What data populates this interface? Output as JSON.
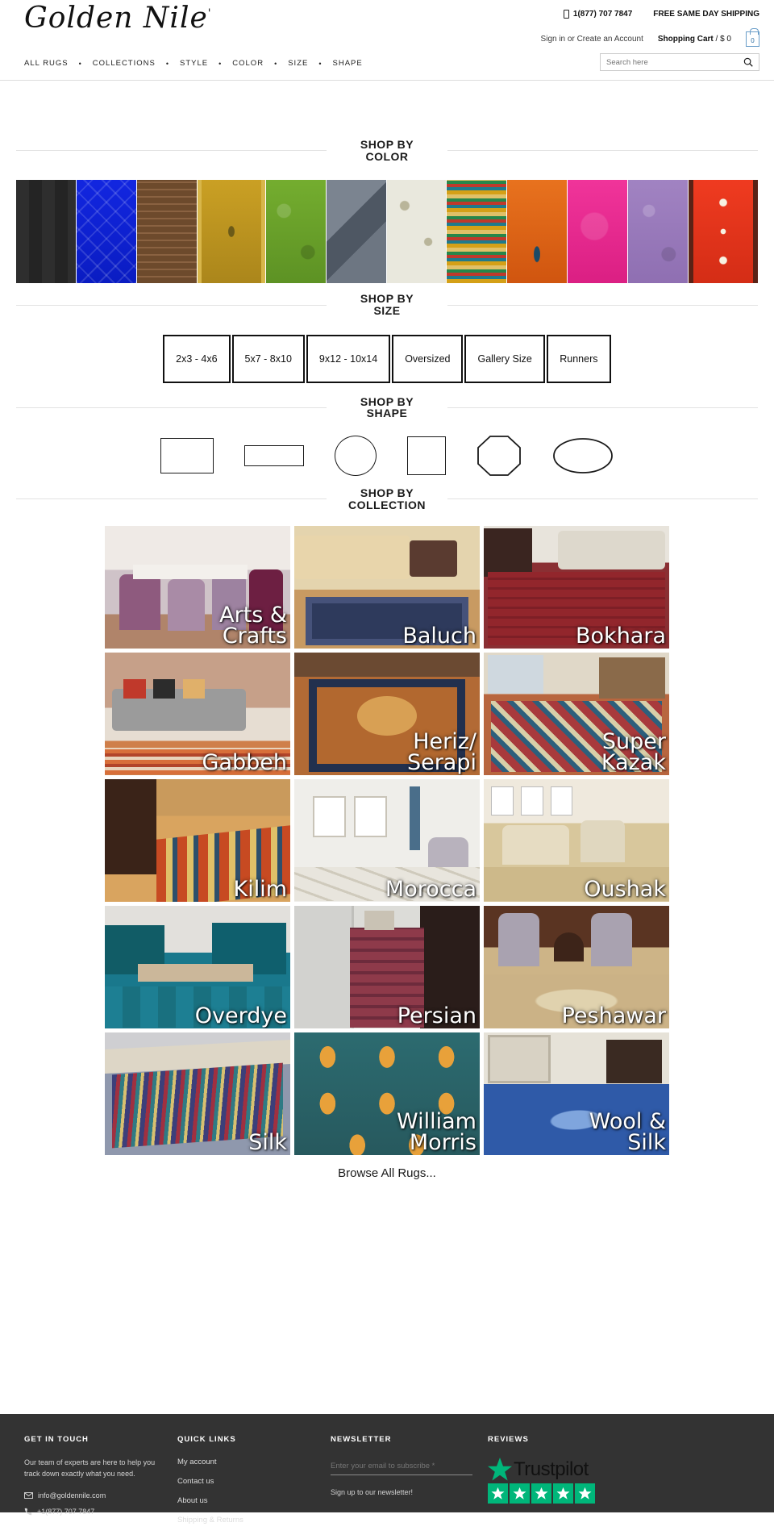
{
  "header": {
    "logo": "Golden Nile",
    "phone": "1(877) 707 7847",
    "shipping_note": "FREE SAME DAY SHIPPING",
    "signin": "Sign in or Create an Account",
    "cart_label": "Shopping Cart",
    "cart_total": "/ $ 0",
    "cart_count": "0",
    "search_placeholder": "Search here",
    "nav": [
      {
        "label": "ALL RUGS"
      },
      {
        "label": "COLLECTIONS"
      },
      {
        "label": "STYLE"
      },
      {
        "label": "COLOR"
      },
      {
        "label": "SIZE"
      },
      {
        "label": "SHAPE"
      }
    ],
    "nav_separator": "•"
  },
  "sections": {
    "color": "SHOP BY\nCOLOR",
    "size": "SHOP BY\nSIZE",
    "shape": "SHOP BY\nSHAPE",
    "collection": "SHOP BY\nCOLLECTION"
  },
  "colors": [
    {
      "name": "black",
      "hex": "#2b2b2b"
    },
    {
      "name": "blue",
      "hex": "#0b22d8"
    },
    {
      "name": "brown",
      "hex": "#6d4a2c"
    },
    {
      "name": "gold",
      "hex": "#c79b20"
    },
    {
      "name": "green",
      "hex": "#6aa52c"
    },
    {
      "name": "grey",
      "hex": "#5c6570"
    },
    {
      "name": "ivory",
      "hex": "#e6e5da"
    },
    {
      "name": "multi",
      "hex": "#b8901f"
    },
    {
      "name": "orange",
      "hex": "#e2641a"
    },
    {
      "name": "pink",
      "hex": "#ef2d94"
    },
    {
      "name": "purple",
      "hex": "#9a77bb"
    },
    {
      "name": "red",
      "hex": "#e13522"
    }
  ],
  "sizes": [
    {
      "label": "2x3 - 4x6"
    },
    {
      "label": "5x7 - 8x10"
    },
    {
      "label": "9x12 - 10x14"
    },
    {
      "label": "Oversized"
    },
    {
      "label": "Gallery Size"
    },
    {
      "label": "Runners"
    }
  ],
  "shapes": [
    {
      "name": "rectangle"
    },
    {
      "name": "runner"
    },
    {
      "name": "round"
    },
    {
      "name": "square"
    },
    {
      "name": "octagon"
    },
    {
      "name": "oval"
    }
  ],
  "collections": [
    {
      "label": "Arts &\nCrafts",
      "tone": "#b7a6ae"
    },
    {
      "label": "Baluch",
      "tone": "#9a8a6d"
    },
    {
      "label": "Bokhara",
      "tone": "#8a3234"
    },
    {
      "label": "Gabbeh",
      "tone": "#b98a6e"
    },
    {
      "label": "Heriz/\nSerapi",
      "tone": "#9c5f35"
    },
    {
      "label": "Super\nKazak",
      "tone": "#a85a55"
    },
    {
      "label": "Kilim",
      "tone": "#b05e2c"
    },
    {
      "label": "Morocca",
      "tone": "#d8d4cd"
    },
    {
      "label": "Oushak",
      "tone": "#cdb587"
    },
    {
      "label": "Overdye",
      "tone": "#1f6a78"
    },
    {
      "label": "Persian",
      "tone": "#8d5a62"
    },
    {
      "label": "Peshawar",
      "tone": "#b8a074"
    },
    {
      "label": "Silk",
      "tone": "#7b8ca8"
    },
    {
      "label": "William\nMorris",
      "tone": "#2c6b70"
    },
    {
      "label": "Wool &\nSilk",
      "tone": "#2f5aa8"
    }
  ],
  "browse_all": "Browse All Rugs...",
  "footer": {
    "get_in_touch": {
      "heading": "GET IN TOUCH",
      "text": "Our team of experts are here to help you track down exactly what you need.",
      "email": "info@goldennile.com",
      "phone": "+1(877) 707 7847"
    },
    "quick_links": {
      "heading": "QUICK LINKS",
      "items": [
        {
          "label": "My account"
        },
        {
          "label": "Contact us"
        },
        {
          "label": "About us"
        },
        {
          "label": "Shipping & Returns"
        }
      ]
    },
    "newsletter": {
      "heading": "NEWSLETTER",
      "placeholder": "Enter your email to subscribe *",
      "subtext": "Sign up to our newsletter!"
    },
    "reviews": {
      "heading": "REVIEWS",
      "brand": "Trustpilot",
      "stars": 5,
      "star_color": "#00b67a"
    }
  }
}
